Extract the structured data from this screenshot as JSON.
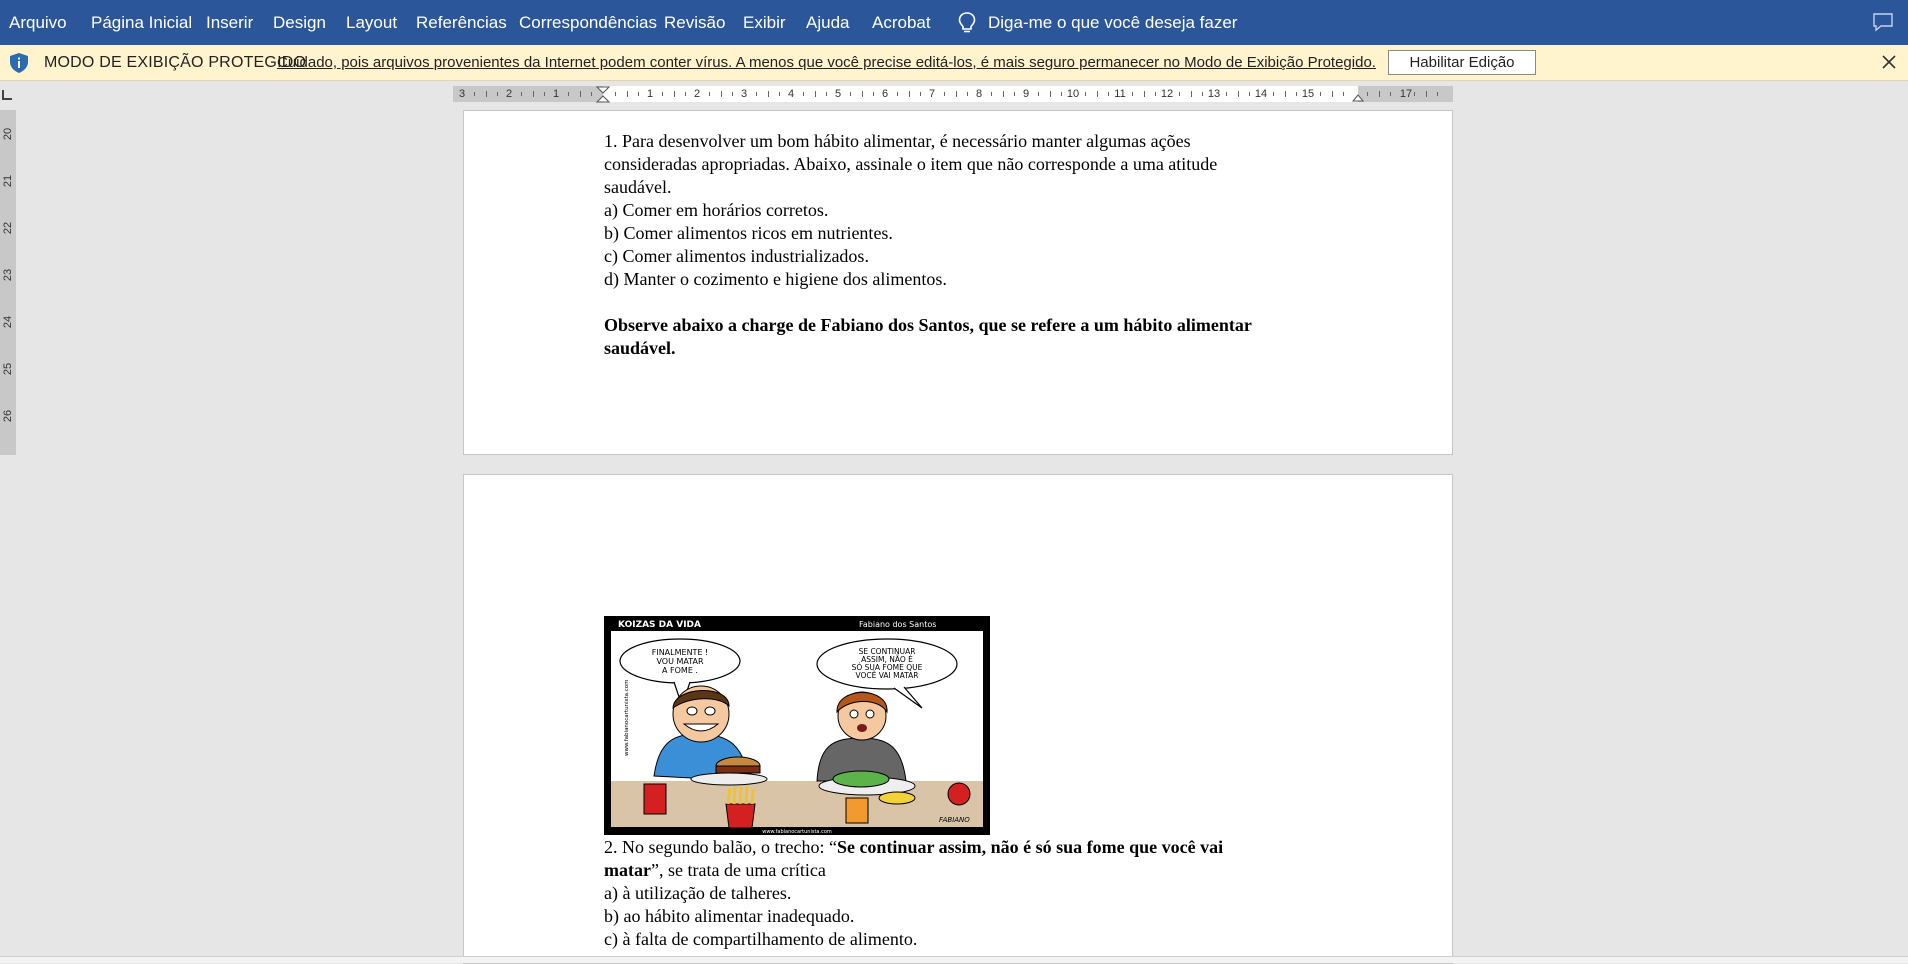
{
  "menu": {
    "tabs": [
      "Arquivo",
      "Página Inicial",
      "Inserir",
      "Design",
      "Layout",
      "Referências",
      "Correspondências",
      "Revisão",
      "Exibir",
      "Ajuda",
      "Acrobat"
    ],
    "tell_me": "Diga-me o que você deseja fazer"
  },
  "protected_view": {
    "title": "MODO DE EXIBIÇÃO PROTEGIDO",
    "message": "Cuidado, pois arquivos provenientes da Internet podem conter vírus. A menos que você precise editá-los, é mais seguro permanecer no Modo de  Exibição Protegido.",
    "enable_button": "Habilitar Edição"
  },
  "ruler": {
    "horizontal": [
      "3",
      "2",
      "1",
      "1",
      "2",
      "3",
      "4",
      "5",
      "6",
      "7",
      "8",
      "9",
      "10",
      "11",
      "12",
      "13",
      "14",
      "15",
      "17"
    ],
    "vertical": [
      "20",
      "21",
      "22",
      "23",
      "24",
      "25",
      "26"
    ]
  },
  "page1": {
    "q1_line1": "1. Para desenvolver um bom hábito alimentar, é necessário manter algumas ações",
    "q1_line2": "consideradas apropriadas. Abaixo, assinale o item que não corresponde a uma atitude",
    "q1_line3": "saudável.",
    "q1_a": "a) Comer em horários corretos.",
    "q1_b": "b) Comer alimentos ricos em nutrientes.",
    "q1_c": "c) Comer alimentos industrializados.",
    "q1_d": "d) Manter o cozimento e higiene dos alimentos.",
    "observe_line1": "Observe abaixo a charge de Fabiano dos Santos, que se refere a um hábito alimentar",
    "observe_line2": "saudável."
  },
  "cartoon": {
    "title": "KOIZAS DA VIDA",
    "author": "Fabiano dos Santos",
    "balloon1": [
      "FINALMENTE !",
      "VOU MATAR",
      "A FOME ."
    ],
    "balloon2": [
      "SE CONTINUAR",
      "ASSIM, NÃO É",
      "SÓ SUA FOME QUE",
      "VOCÊ VAI MATAR"
    ],
    "website_side": "www.fabianocartunista.com",
    "website_bottom": "www.fabianocartunista.com",
    "signature": "FABIANO"
  },
  "page2": {
    "q2_pre": "2. No segundo balão, o trecho: “",
    "q2_bold1": "Se continuar assim, não é só sua fome que você vai",
    "q2_bold2": "matar",
    "q2_post": "”, se trata de uma crítica",
    "q2_a": "a) à utilização de talheres.",
    "q2_b": "b) ao hábito alimentar inadequado.",
    "q2_c": "c) à falta de compartilhamento de alimento."
  }
}
